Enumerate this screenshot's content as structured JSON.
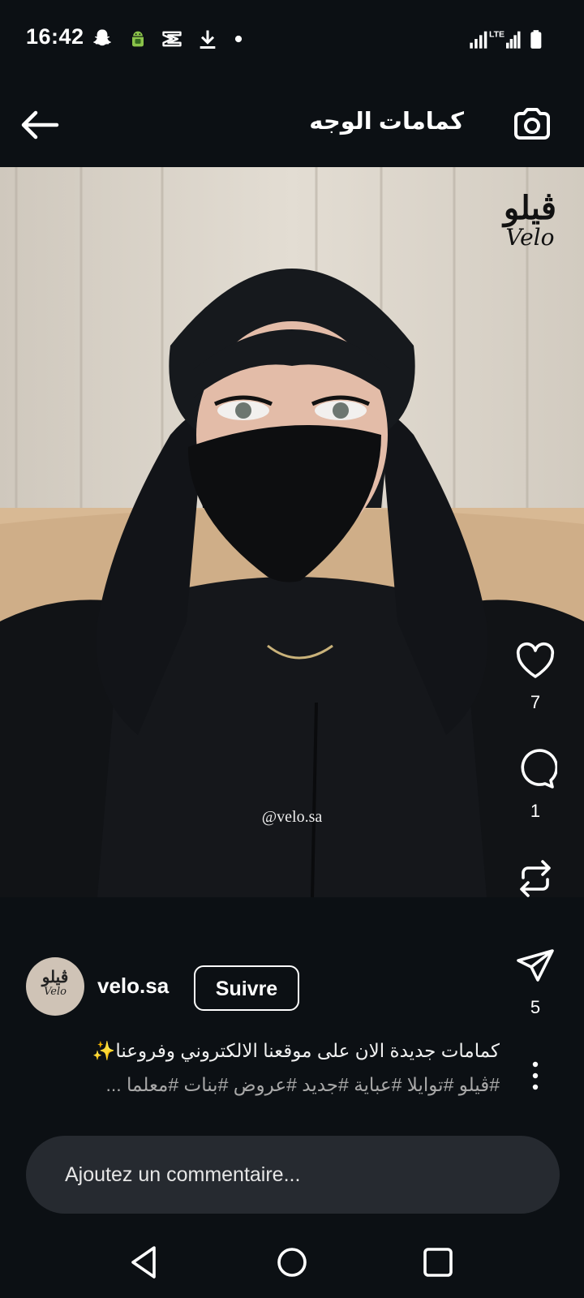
{
  "status_bar": {
    "time": "16:42",
    "left_icons": [
      "snapchat-icon",
      "android-debug-icon",
      "capcut-icon",
      "download-icon",
      "notification-dot-icon"
    ],
    "right_icons": [
      "signal-icon",
      "lte-signal-icon",
      "battery-icon"
    ],
    "lte_label": "LTE"
  },
  "top_bar": {
    "title": "كمامات الوجه",
    "back_icon": "arrow-left-icon",
    "camera_icon": "camera-icon"
  },
  "media": {
    "watermark_arabic": "ڤيلو",
    "watermark_latin": "Velo",
    "handle_overlay": "@velo.sa"
  },
  "actions": {
    "like_count": "7",
    "comment_count": "1",
    "share_count": "5"
  },
  "author": {
    "avatar_arabic": "ڤيلو",
    "avatar_latin": "Velo",
    "username": "velo.sa",
    "follow_label": "Suivre"
  },
  "caption": {
    "line1": "كمامات جديدة الان على موقعنا الالكتروني وفروعنا✨",
    "line2": "#ڤيلو #توايلا #عباية #جديد #عروض #بنات #معلما ..."
  },
  "comment": {
    "placeholder": "Ajoutez un commentaire..."
  },
  "colors": {
    "background": "#0c1014",
    "comment_field": "#262a30",
    "text_primary": "#ffffff",
    "text_secondary": "#a8a8a8"
  }
}
